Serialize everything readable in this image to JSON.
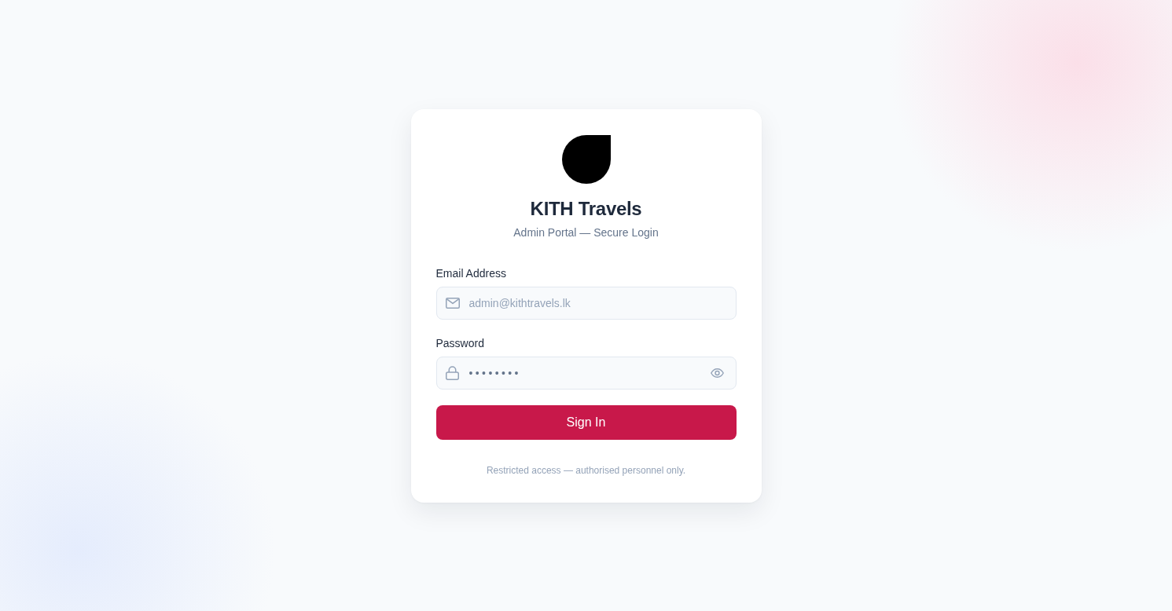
{
  "brand": {
    "name": "KITH Travels",
    "subtitle": "Admin Portal — Secure Login"
  },
  "form": {
    "fields": [
      {
        "kind": "email",
        "label": "Email Address",
        "placeholder": "admin@kithtravels.lk"
      },
      {
        "kind": "password",
        "label": "Password",
        "value": "••••••••"
      }
    ],
    "submit": {
      "label": "Sign In"
    }
  },
  "footer_note": "Restricted access — authorised personnel only."
}
